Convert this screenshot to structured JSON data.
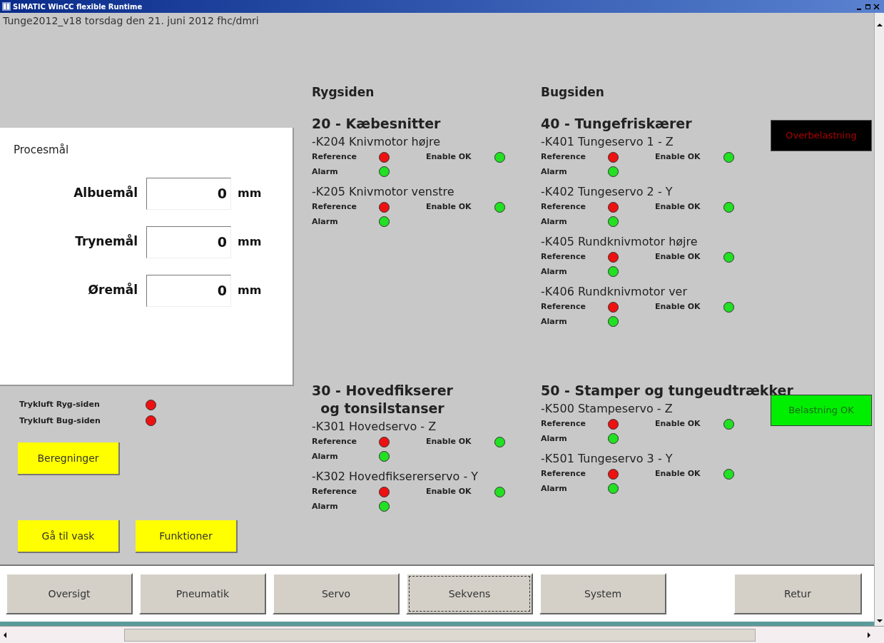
{
  "window": {
    "title": "SIMATIC WinCC flexible Runtime"
  },
  "header": "Tunge2012_v18 torsdag den 21. juni 2012 fhc/dmri",
  "process_panel": {
    "title": "Procesmål",
    "fields": [
      {
        "label": "Albuemål",
        "value": "0",
        "unit": "mm"
      },
      {
        "label": "Trynemål",
        "value": "0",
        "unit": "mm"
      },
      {
        "label": "Øremål",
        "value": "0",
        "unit": "mm"
      }
    ]
  },
  "air_status": [
    {
      "label": "Trykluft Ryg-siden",
      "color": "#ee1111"
    },
    {
      "label": "Trykluft Bug-siden",
      "color": "#ee1111"
    }
  ],
  "action_buttons": [
    [
      "Beregninger"
    ],
    [
      "Gå til vask",
      "Funktioner"
    ]
  ],
  "columns": [
    {
      "heading": "Rygsiden",
      "groups": [
        {
          "title_lines": [
            "20 - Kæbesnitter"
          ],
          "motors": [
            {
              "name": "-K204 Knivmotor højre",
              "signals": [
                {
                  "label": "Reference",
                  "color": "#ee1111"
                },
                {
                  "label": "Enable OK",
                  "color": "#22e022"
                },
                {
                  "label": "Alarm",
                  "color": "#22e022"
                }
              ]
            },
            {
              "name": "-K205 Knivmotor venstre",
              "signals": [
                {
                  "label": "Reference",
                  "color": "#ee1111"
                },
                {
                  "label": "Enable OK",
                  "color": "#22e022"
                },
                {
                  "label": "Alarm",
                  "color": "#22e022"
                }
              ]
            }
          ]
        },
        {
          "title_lines": [
            "30 - Hovedfikserer",
            "og tonsilstanser"
          ],
          "motors": [
            {
              "name": "-K301 Hovedservo - Z",
              "signals": [
                {
                  "label": "Reference",
                  "color": "#ee1111"
                },
                {
                  "label": "Enable OK",
                  "color": "#22e022"
                },
                {
                  "label": "Alarm",
                  "color": "#22e022"
                }
              ]
            },
            {
              "name": "-K302 Hovedfiksererservo - Y",
              "signals": [
                {
                  "label": "Reference",
                  "color": "#ee1111"
                },
                {
                  "label": "Enable OK",
                  "color": "#22e022"
                },
                {
                  "label": "Alarm",
                  "color": "#22e022"
                }
              ]
            }
          ]
        }
      ]
    },
    {
      "heading": "Bugsiden",
      "groups": [
        {
          "title_lines": [
            "40 - Tungefriskærer"
          ],
          "motors": [
            {
              "name": "-K401 Tungeservo 1 - Z",
              "signals": [
                {
                  "label": "Reference",
                  "color": "#ee1111"
                },
                {
                  "label": "Enable OK",
                  "color": "#22e022"
                },
                {
                  "label": "Alarm",
                  "color": "#22e022"
                }
              ]
            },
            {
              "name": "-K402 Tungeservo 2 - Y",
              "signals": [
                {
                  "label": "Reference",
                  "color": "#ee1111"
                },
                {
                  "label": "Enable OK",
                  "color": "#22e022"
                },
                {
                  "label": "Alarm",
                  "color": "#22e022"
                }
              ]
            },
            {
              "name": "-K405 Rundknivmotor højre",
              "signals": [
                {
                  "label": "Reference",
                  "color": "#ee1111"
                },
                {
                  "label": "Enable OK",
                  "color": "#22e022"
                },
                {
                  "label": "Alarm",
                  "color": "#22e022"
                }
              ]
            },
            {
              "name": "-K406 Rundknivmotor ver",
              "signals": [
                {
                  "label": "Reference",
                  "color": "#ee1111"
                },
                {
                  "label": "Enable OK",
                  "color": "#22e022"
                },
                {
                  "label": "Alarm",
                  "color": "#22e022"
                }
              ]
            }
          ]
        },
        {
          "title_lines": [
            "50 - Stamper og tungeudtrækker"
          ],
          "motors": [
            {
              "name": "-K500 Stampeservo - Z",
              "signals": [
                {
                  "label": "Reference",
                  "color": "#ee1111"
                },
                {
                  "label": "Enable OK",
                  "color": "#22e022"
                },
                {
                  "label": "Alarm",
                  "color": "#22e022"
                }
              ]
            },
            {
              "name": "-K501 Tungeservo 3 - Y",
              "signals": [
                {
                  "label": "Reference",
                  "color": "#ee1111"
                },
                {
                  "label": "Enable OK",
                  "color": "#22e022"
                },
                {
                  "label": "Alarm",
                  "color": "#22e022"
                }
              ]
            }
          ]
        }
      ]
    }
  ],
  "load_indicators": [
    {
      "text": "Overbelastning",
      "kind": "alarm"
    },
    {
      "text": "Belastning OK",
      "kind": "ok"
    }
  ],
  "nav_buttons": [
    {
      "label": "Oversigt",
      "selected": false
    },
    {
      "label": "Pneumatik",
      "selected": false
    },
    {
      "label": "Servo",
      "selected": false
    },
    {
      "label": "Sekvens",
      "selected": true
    },
    {
      "label": "System",
      "selected": false
    }
  ],
  "return_button": "Retur"
}
